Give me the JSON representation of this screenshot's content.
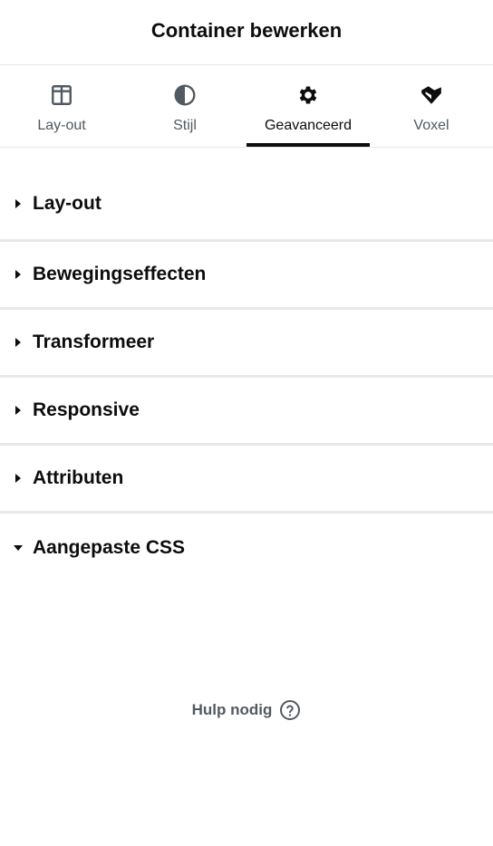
{
  "header": {
    "title": "Container bewerken"
  },
  "tabs": [
    {
      "label": "Lay-out",
      "icon": "columns-icon"
    },
    {
      "label": "Stijl",
      "icon": "half-circle-icon"
    },
    {
      "label": "Geavanceerd",
      "icon": "gear-icon",
      "active": true
    },
    {
      "label": "Voxel",
      "icon": "voxel-logo-icon"
    }
  ],
  "sections": [
    {
      "label": "Lay-out",
      "state": "collapsed"
    },
    {
      "label": "Bewegingseffecten",
      "state": "collapsed"
    },
    {
      "label": "Transformeer",
      "state": "collapsed"
    },
    {
      "label": "Responsive",
      "state": "collapsed"
    },
    {
      "label": "Attributen",
      "state": "collapsed"
    },
    {
      "label": "Aangepaste CSS",
      "state": "expanded"
    }
  ],
  "help": {
    "label": "Hulp nodig",
    "icon": "question-circle-icon"
  },
  "colors": {
    "text": "#0c0d0e",
    "muted": "#515962",
    "divider": "#e6e8ea"
  }
}
